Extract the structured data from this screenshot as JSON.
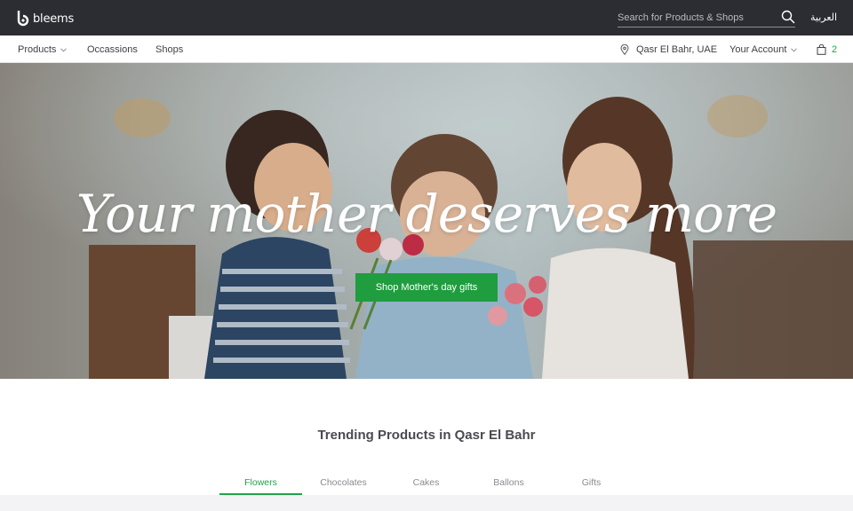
{
  "brand": {
    "name": "bleems",
    "accent": "#22a24a",
    "topbar_color": "#2b2d33"
  },
  "search": {
    "placeholder": "Search for Products & Shops",
    "icon": "search-icon"
  },
  "language_toggle": "العربية",
  "nav": {
    "products": "Products",
    "occasions": "Occassions",
    "shops": "Shops",
    "location": "Qasr El Bahr, UAE",
    "account": "Your Account",
    "cart_count": "2"
  },
  "hero": {
    "title": "Your mother deserves more",
    "cta": "Shop Mother's day gifts"
  },
  "trending": {
    "title": "Trending Products in Qasr El Bahr",
    "tabs": [
      "Flowers",
      "Chocolates",
      "Cakes",
      "Ballons",
      "Gifts"
    ],
    "active_tab": "Flowers"
  }
}
